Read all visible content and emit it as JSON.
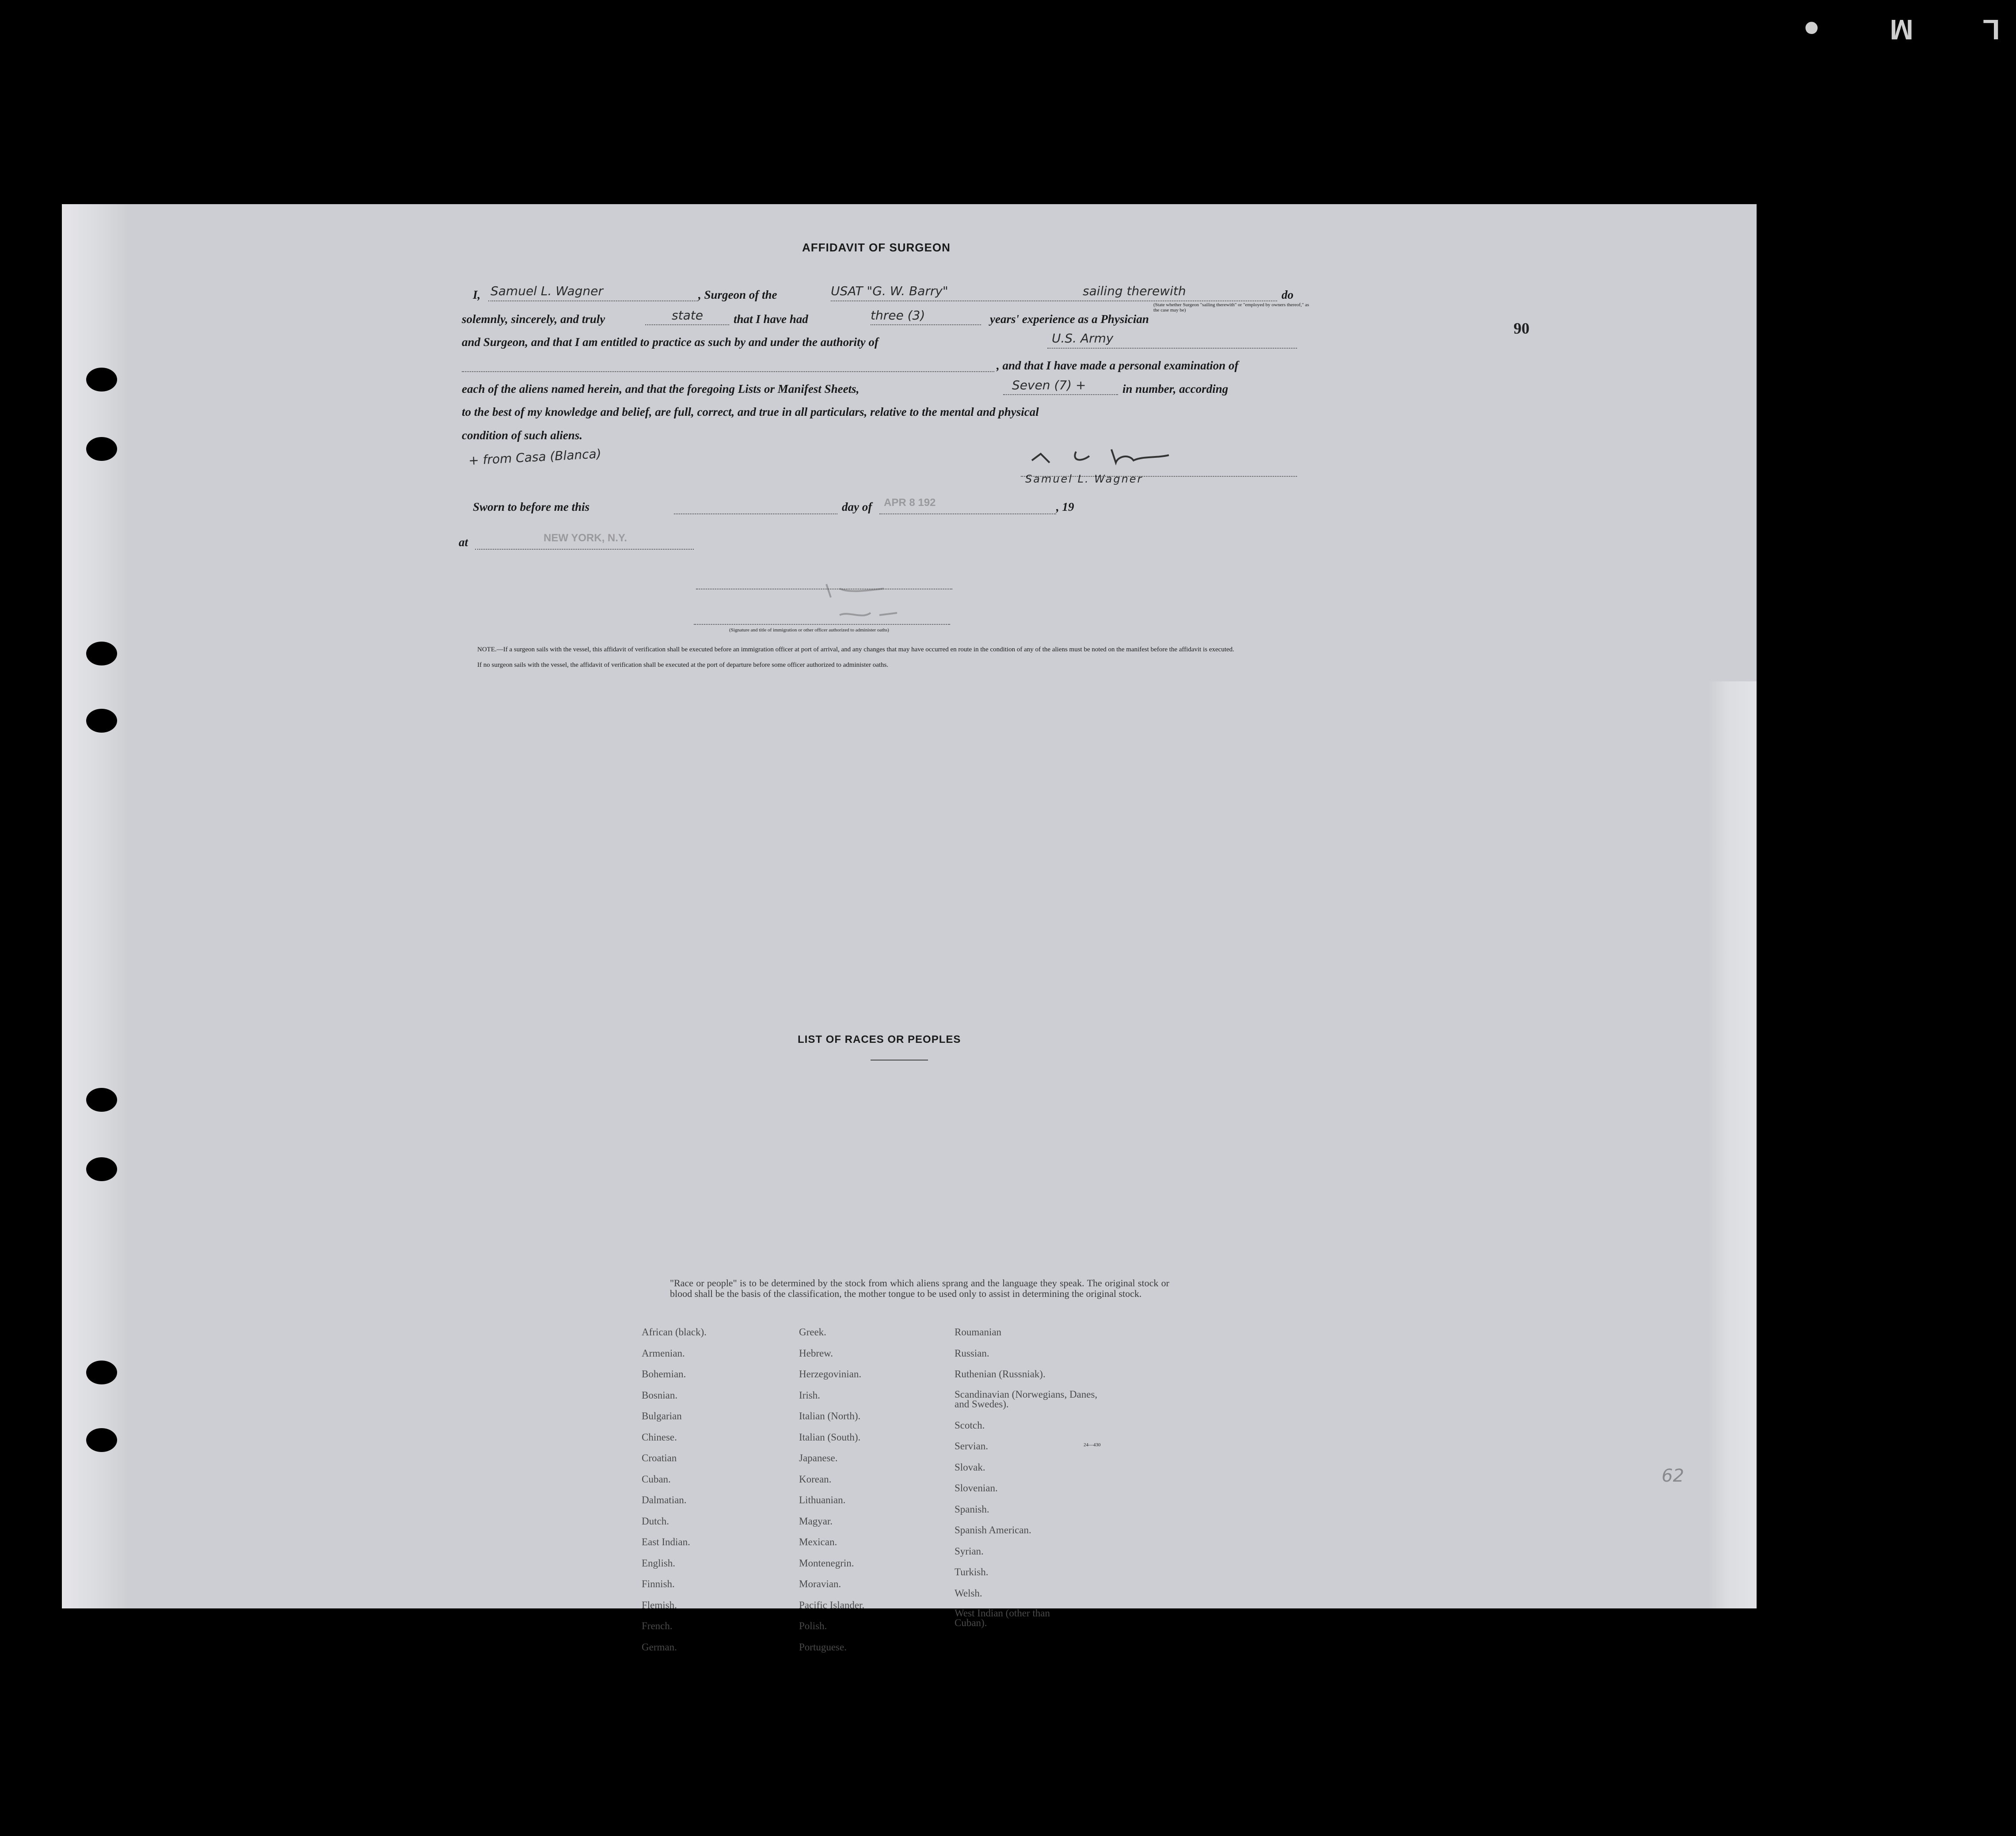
{
  "film_mark": "L M ●",
  "affidavit": {
    "title": "AFFIDAVIT OF SURGEON",
    "line1_pre": "I,",
    "surgeon_name": "Samuel L. Wagner",
    "line1_mid": ", Surgeon of the",
    "ship": "USAT \"G. W. Barry\"",
    "sailing": "sailing therewith",
    "line1_end": "do",
    "state_note": "(State whether Surgeon \"sailing therewith\" or \"employed by owners thereof,\" as the case may be)",
    "line2_pre": "solemnly, sincerely, and truly",
    "state_word": "state",
    "line2_mid": "that I have had",
    "years": "three (3)",
    "line2_end": "years' experience as a Physician",
    "line3": "and Surgeon, and that I am entitled to practice as such by and under the authority of",
    "authority": "U.S. Army",
    "line4": ", and that I have made a personal examination of",
    "line5_pre": "each of the aliens named herein, and that the foregoing Lists or Manifest Sheets,",
    "sheets": "Seven (7) +",
    "line5_end": "in number, according",
    "line6": "to the best of my knowledge and belief, are full, correct, and true in all particulars, relative to the mental and physical",
    "line7": "condition of such aliens.",
    "margin_note": "+ from Casa (Blanca)",
    "signature_printed": "Samuel L. Wagner",
    "sworn_pre": "Sworn to before me this",
    "sworn_day": "day of",
    "sworn_date_stamp": "APR 8 192",
    "sworn_year": ", 19",
    "at_label": "at",
    "at_stamp": "NEW YORK, N.Y.",
    "officer_caption": "(Signature and title of immigration or other officer authorized to administer oaths)",
    "note1": "NOTE.—If a surgeon sails with the vessel, this affidavit of verification shall be executed before an immigration officer at port of arrival, and any changes that may have occurred en route in the condition of any of the aliens must be noted on the manifest before the affidavit is executed.",
    "note2": "If no surgeon sails with the vessel, the affidavit of verification shall be executed at the port of departure before some officer authorized to administer oaths.",
    "page_number": "90"
  },
  "races": {
    "title": "LIST OF RACES OR PEOPLES",
    "intro": "\"Race or people\" is to be determined by the stock from which aliens sprang and the language they speak. The original stock or blood shall be the basis of the classification, the mother tongue to be used only to assist in determining the original stock.",
    "col1": [
      "African (black).",
      "Armenian.",
      "Bohemian.",
      "Bosnian.",
      "Bulgarian",
      "Chinese.",
      "Croatian",
      "Cuban.",
      "Dalmatian.",
      "Dutch.",
      "East Indian.",
      "English.",
      "Finnish.",
      "Flemish.",
      "French.",
      "German."
    ],
    "col2": [
      "Greek.",
      "Hebrew.",
      "Herzegovinian.",
      "Irish.",
      "Italian (North).",
      "Italian (South).",
      "Japanese.",
      "Korean.",
      "Lithuanian.",
      "Magyar.",
      "Mexican.",
      "Montenegrin.",
      "Moravian.",
      "Pacific Islander.",
      "Polish.",
      "Portuguese."
    ],
    "col3": [
      "Roumanian",
      "Russian.",
      "Ruthenian (Russniak).",
      "Scandinavian (Norwegians, Danes, and Swedes).",
      "Scotch.",
      "Servian.",
      "Slovak.",
      "Slovenian.",
      "Spanish.",
      "Spanish American.",
      "Syrian.",
      "Turkish.",
      "Welsh.",
      "West Indian (other than Cuban)."
    ],
    "form_number": "24—430"
  },
  "corner_mark": "62"
}
